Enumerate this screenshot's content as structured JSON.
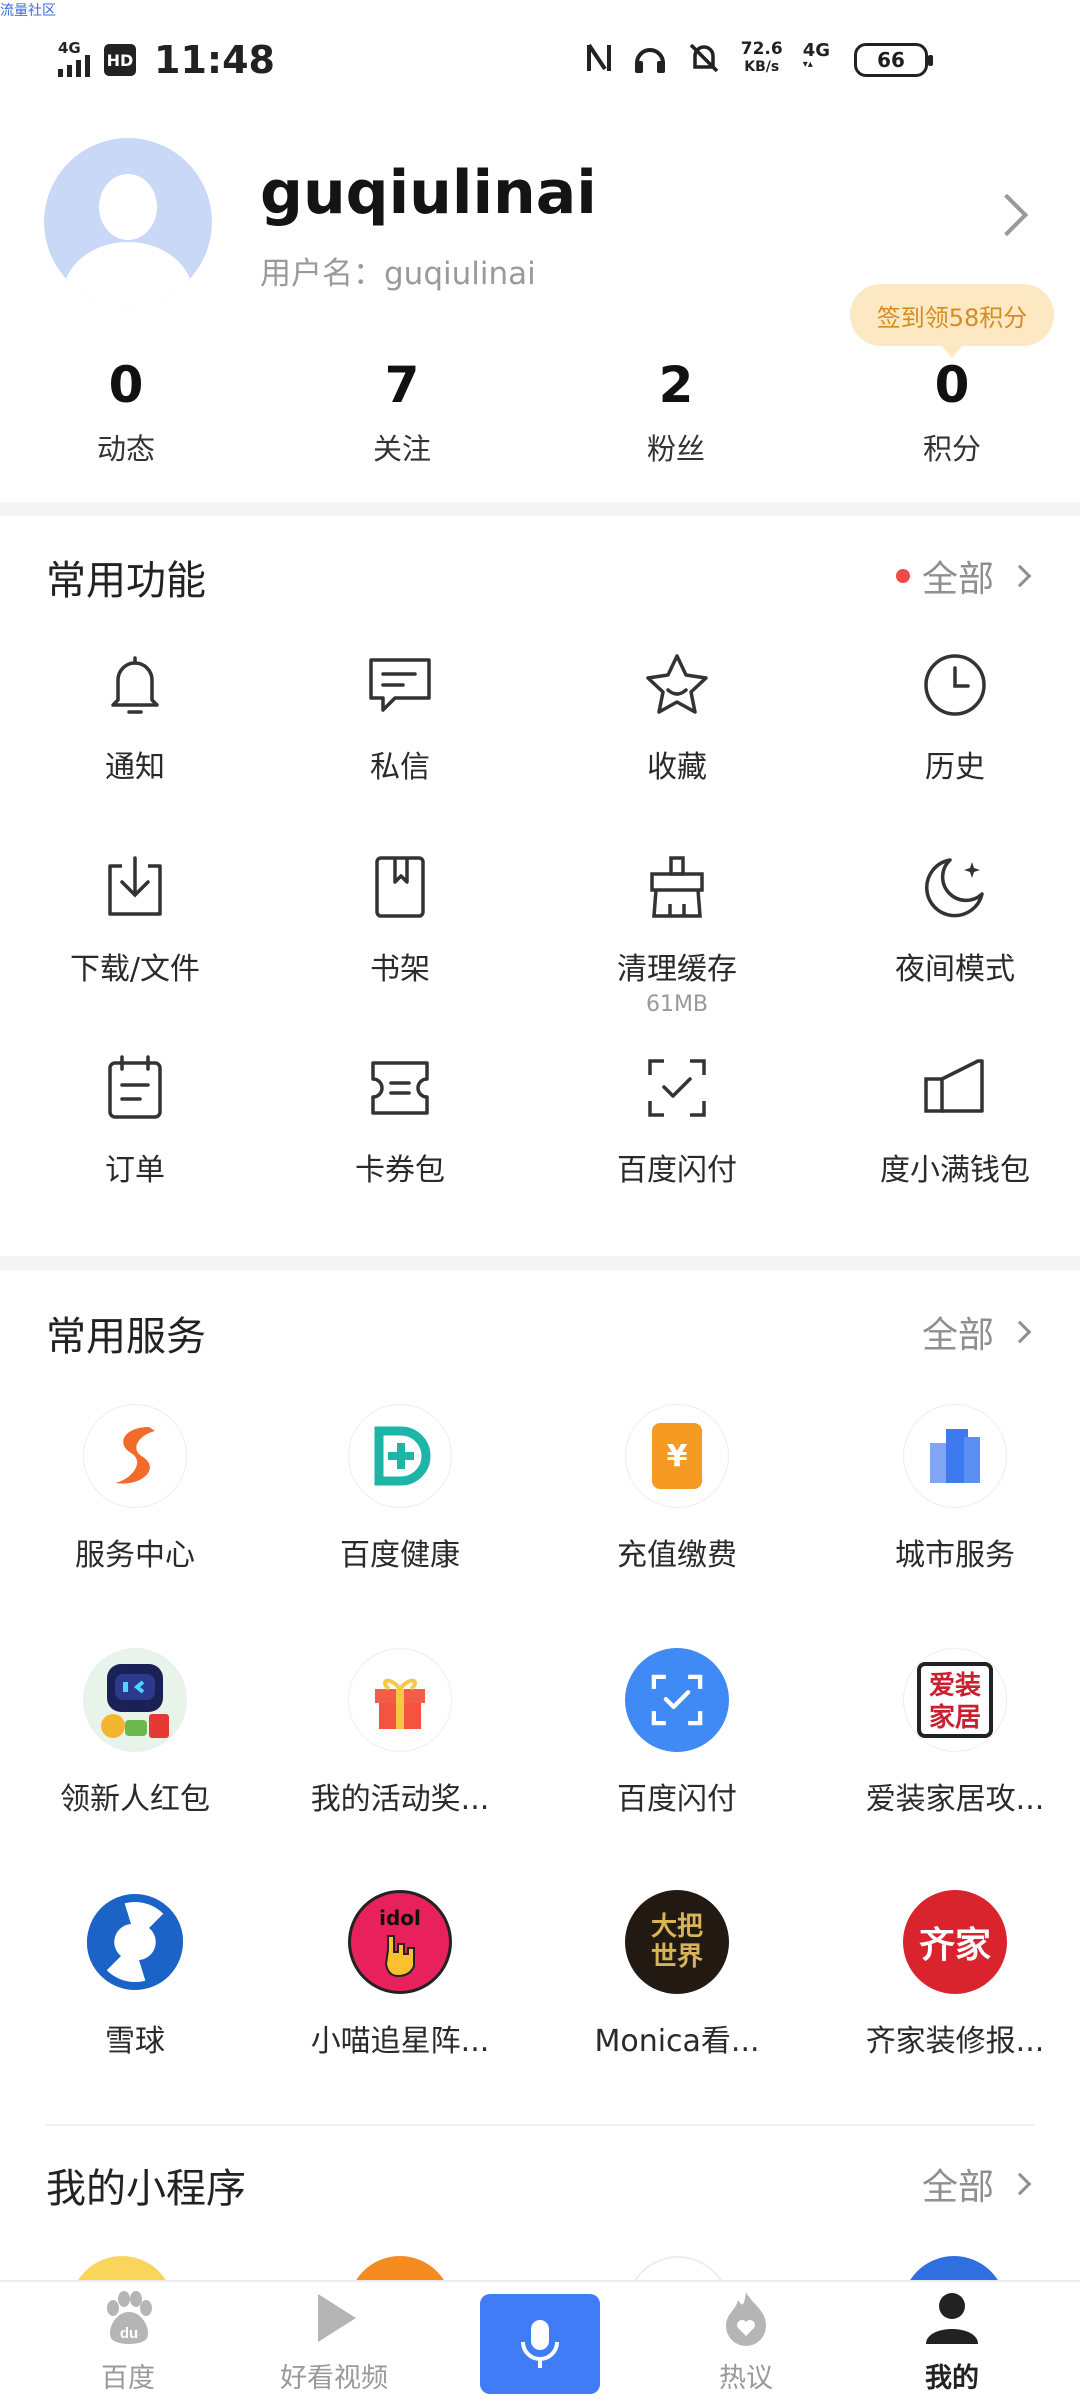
{
  "watermark": "流量社区",
  "status_bar": {
    "time": "11:48",
    "network": "4G",
    "hd": "HD",
    "speed_value": "72.6",
    "speed_unit": "KB/s",
    "network2": "4G",
    "battery": "66"
  },
  "profile": {
    "display_name": "guqiulinai",
    "username_line": "用户名：guqiulinai",
    "signin_tip": "签到领58积分",
    "stats": [
      {
        "value": "0",
        "label": "动态"
      },
      {
        "value": "7",
        "label": "关注"
      },
      {
        "value": "2",
        "label": "粉丝"
      },
      {
        "value": "0",
        "label": "积分"
      }
    ]
  },
  "common_functions": {
    "title": "常用功能",
    "all_label": "全部",
    "items": [
      {
        "label": "通知",
        "icon": "bell-icon"
      },
      {
        "label": "私信",
        "icon": "message-icon"
      },
      {
        "label": "收藏",
        "icon": "star-icon"
      },
      {
        "label": "历史",
        "icon": "clock-icon"
      },
      {
        "label": "下载/文件",
        "icon": "download-icon"
      },
      {
        "label": "书架",
        "icon": "bookshelf-icon"
      },
      {
        "label": "清理缓存",
        "sub": "61MB",
        "icon": "broom-icon"
      },
      {
        "label": "夜间模式",
        "icon": "moon-icon"
      },
      {
        "label": "订单",
        "icon": "order-icon"
      },
      {
        "label": "卡券包",
        "icon": "coupon-icon"
      },
      {
        "label": "百度闪付",
        "icon": "scan-pay-icon"
      },
      {
        "label": "度小满钱包",
        "icon": "wallet-icon"
      }
    ]
  },
  "common_services": {
    "title": "常用服务",
    "all_label": "全部",
    "items": [
      {
        "label": "服务中心",
        "icon": "service-center-icon"
      },
      {
        "label": "百度健康",
        "icon": "health-icon"
      },
      {
        "label": "充值缴费",
        "icon": "recharge-icon",
        "glyph": "¥"
      },
      {
        "label": "城市服务",
        "icon": "city-icon"
      },
      {
        "label": "领新人红包",
        "icon": "robot-redpacket-icon"
      },
      {
        "label": "我的活动奖...",
        "icon": "gift-icon"
      },
      {
        "label": "百度闪付",
        "icon": "flash-pay-icon"
      },
      {
        "label": "爱装家居攻...",
        "icon": "home-decor-icon",
        "glyph": "爱装家居"
      },
      {
        "label": "雪球",
        "icon": "snowball-icon"
      },
      {
        "label": "小喵追星阵...",
        "icon": "idol-icon",
        "glyph": "idol"
      },
      {
        "label": "Monica看...",
        "icon": "monica-icon",
        "glyph": "大把世界"
      },
      {
        "label": "齐家装修报...",
        "icon": "qijia-icon",
        "glyph": "齐家"
      }
    ]
  },
  "mini_programs": {
    "title": "我的小程序",
    "all_label": "全部"
  },
  "tabbar": {
    "items": [
      {
        "label": "百度"
      },
      {
        "label": "好看视频"
      },
      {
        "label": "热议"
      },
      {
        "label": "我的"
      }
    ]
  },
  "colors": {
    "accent_blue": "#3f7cf5",
    "signin_bg": "#fde8c4",
    "signin_text": "#d88b1d"
  }
}
